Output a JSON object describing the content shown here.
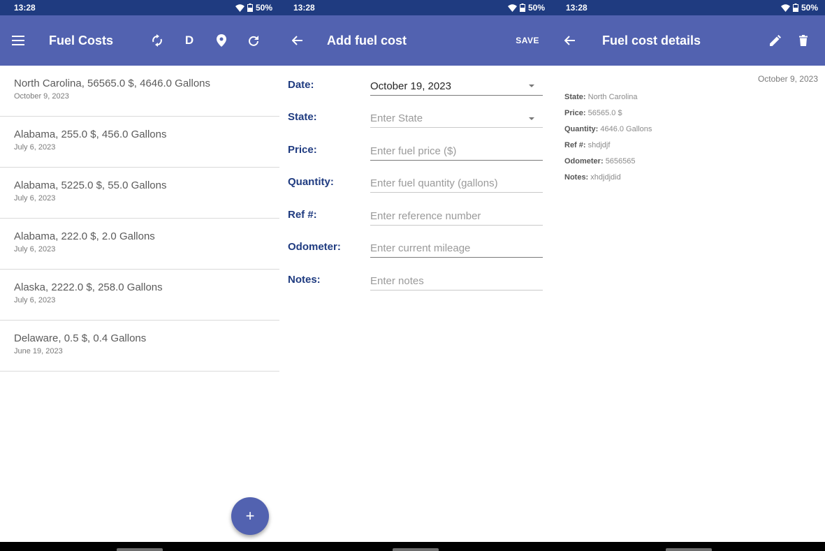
{
  "status": {
    "time": "13:28",
    "battery": "50%"
  },
  "screen1": {
    "title": "Fuel Costs",
    "icons": [
      "menu-icon",
      "sync-icon",
      "letter-d-icon",
      "location-pin-icon",
      "refresh-icon"
    ],
    "action_d_label": "D",
    "items": [
      {
        "primary": "North Carolina, 56565.0 $, 4646.0 Gallons",
        "secondary": "October 9, 2023"
      },
      {
        "primary": "Alabama, 255.0 $, 456.0 Gallons",
        "secondary": "July 6, 2023"
      },
      {
        "primary": "Alabama, 5225.0 $, 55.0 Gallons",
        "secondary": "July 6, 2023"
      },
      {
        "primary": "Alabama, 222.0 $, 2.0 Gallons",
        "secondary": "July 6, 2023"
      },
      {
        "primary": "Alaska, 2222.0 $, 258.0 Gallons",
        "secondary": "July 6, 2023"
      },
      {
        "primary": "Delaware, 0.5 $, 0.4 Gallons",
        "secondary": "June 19, 2023"
      }
    ],
    "fab_label": "+"
  },
  "screen2": {
    "title": "Add fuel cost",
    "save_label": "SAVE",
    "fields": [
      {
        "label": "Date:",
        "value": "October 19, 2023",
        "placeholder": ""
      },
      {
        "label": "State:",
        "value": "",
        "placeholder": "Enter State"
      },
      {
        "label": "Price:",
        "value": "",
        "placeholder": "Enter fuel price ($)"
      },
      {
        "label": "Quantity:",
        "value": "",
        "placeholder": "Enter fuel quantity (gallons)"
      },
      {
        "label": "Ref #:",
        "value": "",
        "placeholder": "Enter reference number"
      },
      {
        "label": "Odometer:",
        "value": "",
        "placeholder": "Enter current mileage"
      },
      {
        "label": "Notes:",
        "value": "",
        "placeholder": "Enter notes"
      }
    ]
  },
  "screen3": {
    "title": "Fuel cost details",
    "date": "October 9, 2023",
    "details": [
      {
        "label": "State:",
        "value": "North Carolina"
      },
      {
        "label": "Price:",
        "value": "56565.0 $"
      },
      {
        "label": "Quantity:",
        "value": "4646.0 Gallons"
      },
      {
        "label": "Ref #:",
        "value": "shdjdjf"
      },
      {
        "label": "Odometer:",
        "value": "5656565"
      },
      {
        "label": "Notes:",
        "value": "xhdjdjdid"
      }
    ]
  }
}
